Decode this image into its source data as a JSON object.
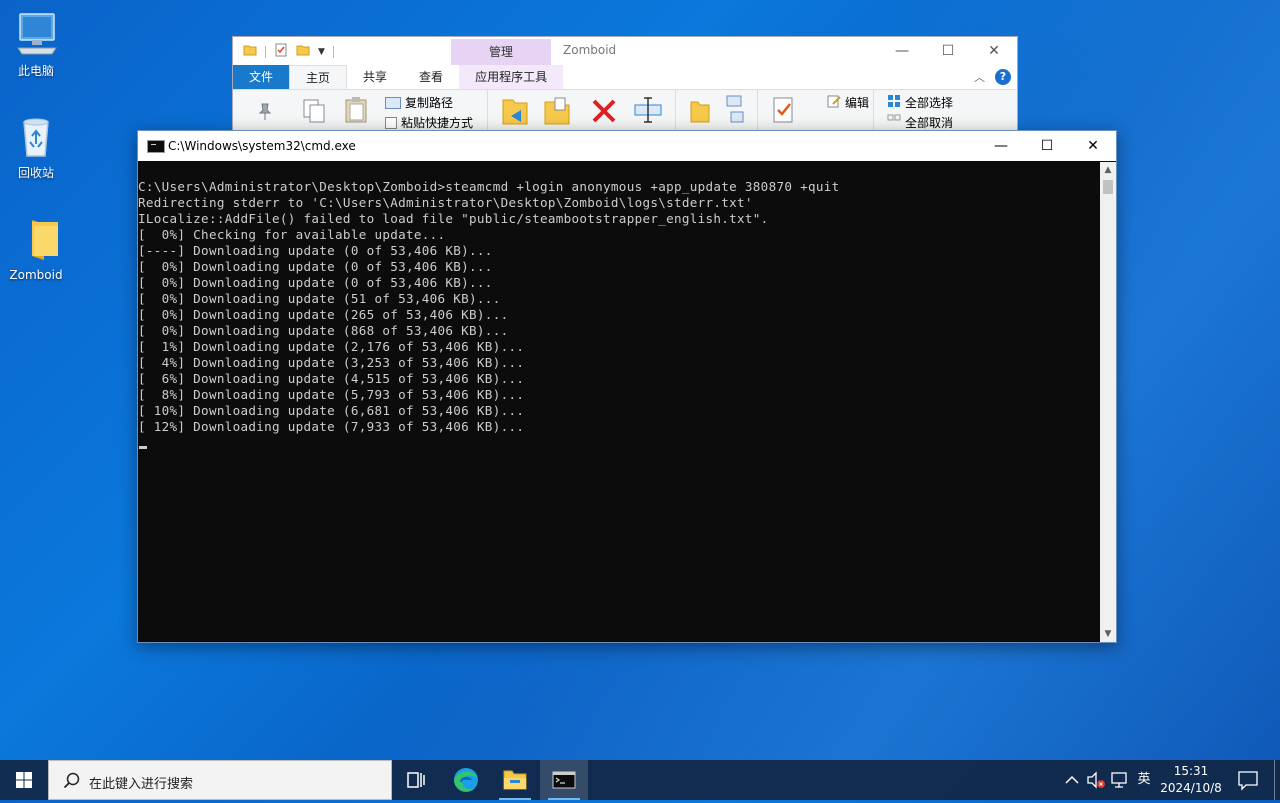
{
  "desktop": {
    "icons": [
      {
        "label": "此电脑",
        "icon": "this-pc-icon"
      },
      {
        "label": "回收站",
        "icon": "recycle-bin-icon"
      },
      {
        "label": "Zomboid",
        "icon": "folder-icon"
      }
    ]
  },
  "explorer": {
    "title": "Zomboid",
    "context_tab": "管理",
    "tabs": [
      "文件",
      "主页",
      "共享",
      "查看",
      "应用程序工具"
    ],
    "active_tab": "主页",
    "ribbon": {
      "copy_path": "复制路径",
      "paste_shortcut": "粘贴快捷方式",
      "edit": "编辑",
      "select_all": "全部选择",
      "select_none": "全部取消"
    },
    "controls": {
      "minimize": "—",
      "maximize": "☐",
      "close": "✕"
    },
    "help": "?"
  },
  "cmd": {
    "title": "C:\\Windows\\system32\\cmd.exe",
    "controls": {
      "minimize": "—",
      "maximize": "☐",
      "close": "✕"
    },
    "lines": [
      "C:\\Users\\Administrator\\Desktop\\Zomboid>steamcmd +login anonymous +app_update 380870 +quit",
      "Redirecting stderr to 'C:\\Users\\Administrator\\Desktop\\Zomboid\\logs\\stderr.txt'",
      "ILocalize::AddFile() failed to load file \"public/steambootstrapper_english.txt\".",
      "[  0%] Checking for available update...",
      "[----] Downloading update (0 of 53,406 KB)...",
      "[  0%] Downloading update (0 of 53,406 KB)...",
      "[  0%] Downloading update (0 of 53,406 KB)...",
      "[  0%] Downloading update (51 of 53,406 KB)...",
      "[  0%] Downloading update (265 of 53,406 KB)...",
      "[  0%] Downloading update (868 of 53,406 KB)...",
      "[  1%] Downloading update (2,176 of 53,406 KB)...",
      "[  4%] Downloading update (3,253 of 53,406 KB)...",
      "[  6%] Downloading update (4,515 of 53,406 KB)...",
      "[  8%] Downloading update (5,793 of 53,406 KB)...",
      "[ 10%] Downloading update (6,681 of 53,406 KB)...",
      "[ 12%] Downloading update (7,933 of 53,406 KB)..."
    ]
  },
  "taskbar": {
    "search_placeholder": "在此键入进行搜索",
    "apps": [
      "task-view-icon",
      "edge-icon",
      "file-explorer-icon",
      "cmd-icon"
    ],
    "active_app": "cmd-icon",
    "tray": {
      "ime": "英",
      "time": "15:31",
      "date": "2024/10/8"
    }
  },
  "colors": {
    "console_bg": "#0c0c0c",
    "console_fg": "#cccccc",
    "ribbon_file_tab": "#1979ca",
    "manage_tab": "#e7d3f4"
  }
}
